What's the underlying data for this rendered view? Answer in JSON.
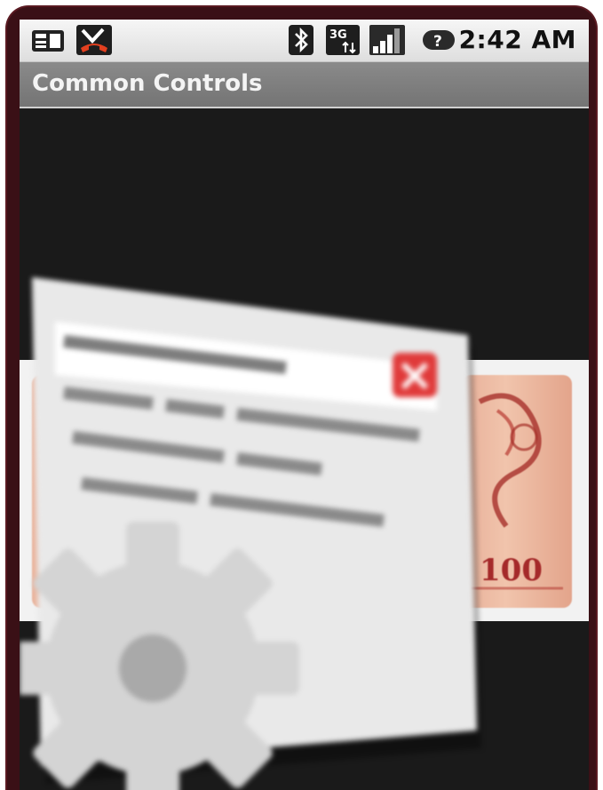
{
  "status_bar": {
    "time": "2:42 AM",
    "icons": [
      "notification-card-icon",
      "missed-call-icon",
      "bluetooth-icon",
      "3g-data-icon",
      "signal-strength-icon",
      "battery-unknown-icon"
    ]
  },
  "title_bar": {
    "title": "Common Controls"
  },
  "content": {
    "banknote_value": "100"
  },
  "colors": {
    "frame": "#3a1016",
    "screen_bg": "#1a1a1a",
    "title_bar_bg": "#7e7e7e",
    "status_bar_bg": "#e8e8e8",
    "close_badge": "#e03a3a"
  }
}
